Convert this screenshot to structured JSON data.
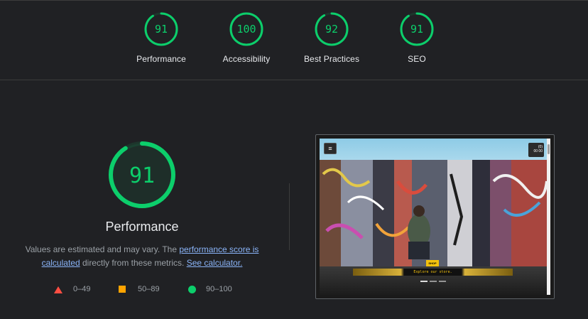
{
  "colors": {
    "pass": "#0cce6b",
    "average": "#ffa400",
    "fail": "#ff4e42",
    "link": "#8ab4f8",
    "background": "#202124"
  },
  "categories": [
    {
      "score": "91",
      "label": "Performance",
      "fraction": 0.91
    },
    {
      "score": "100",
      "label": "Accessibility",
      "fraction": 1.0
    },
    {
      "score": "92",
      "label": "Best Practices",
      "fraction": 0.92
    },
    {
      "score": "91",
      "label": "SEO",
      "fraction": 0.91
    }
  ],
  "performance": {
    "score": "91",
    "fraction": 0.91,
    "title": "Performance",
    "desc_prefix": "Values are estimated and may vary. The ",
    "desc_link1": "performance score is calculated",
    "desc_middle": " directly from these metrics. ",
    "desc_link2": "See calculator."
  },
  "legend": [
    {
      "icon": "triangle-fail-icon",
      "range": "0–49"
    },
    {
      "icon": "square-average-icon",
      "range": "50–89"
    },
    {
      "icon": "circle-pass-icon",
      "range": "90–100"
    }
  ],
  "screenshot": {
    "menu_icon": "hamburger-icon",
    "cart_line1": "(0)",
    "cart_line2": "00 00",
    "shop_label": "SHOP",
    "explore_label": "Explore our store."
  }
}
